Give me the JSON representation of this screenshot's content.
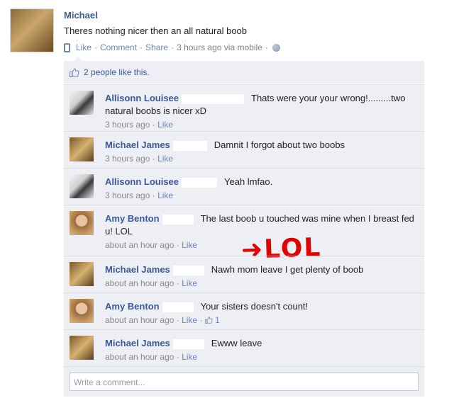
{
  "post": {
    "author": "Michael",
    "text": "Theres nothing nicer then an all natural boob",
    "like_label": "Like",
    "comment_label": "Comment",
    "share_label": "Share",
    "time": "3 hours ago via mobile",
    "sep": "·"
  },
  "likes": {
    "text": "2 people like this."
  },
  "comments": [
    {
      "author": "Allisonn Louisee",
      "text": "Thats were your your wrong!.........two natural boobs is nicer xD",
      "time": "3 hours ago",
      "like": "Like"
    },
    {
      "author": "Michael James",
      "text": "Damnit I forgot about two boobs",
      "time": "3 hours ago",
      "like": "Like"
    },
    {
      "author": "Allisonn Louisee",
      "text": "Yeah lmfao.",
      "time": "3 hours ago",
      "like": "Like"
    },
    {
      "author": "Amy Benton",
      "text": "The last boob u touched was mine when I breast fed u! LOL",
      "time": "about an hour ago",
      "like": "Like"
    },
    {
      "author": "Michael James",
      "text": "Nawh mom leave I get plenty of boob",
      "time": "about an hour ago",
      "like": "Like"
    },
    {
      "author": "Amy Benton",
      "text": "Your sisters doesn't count!",
      "time": "about an hour ago",
      "like": "Like",
      "like_count": "1"
    },
    {
      "author": "Michael James",
      "text": "Ewww leave",
      "time": "about an hour ago",
      "like": "Like"
    }
  ],
  "annotation": {
    "text": "LOL",
    "color": "#e10000"
  },
  "write_comment": {
    "placeholder": "Write a comment..."
  },
  "colors": {
    "link": "#3b5998",
    "comment_bg": "#edeff4"
  }
}
